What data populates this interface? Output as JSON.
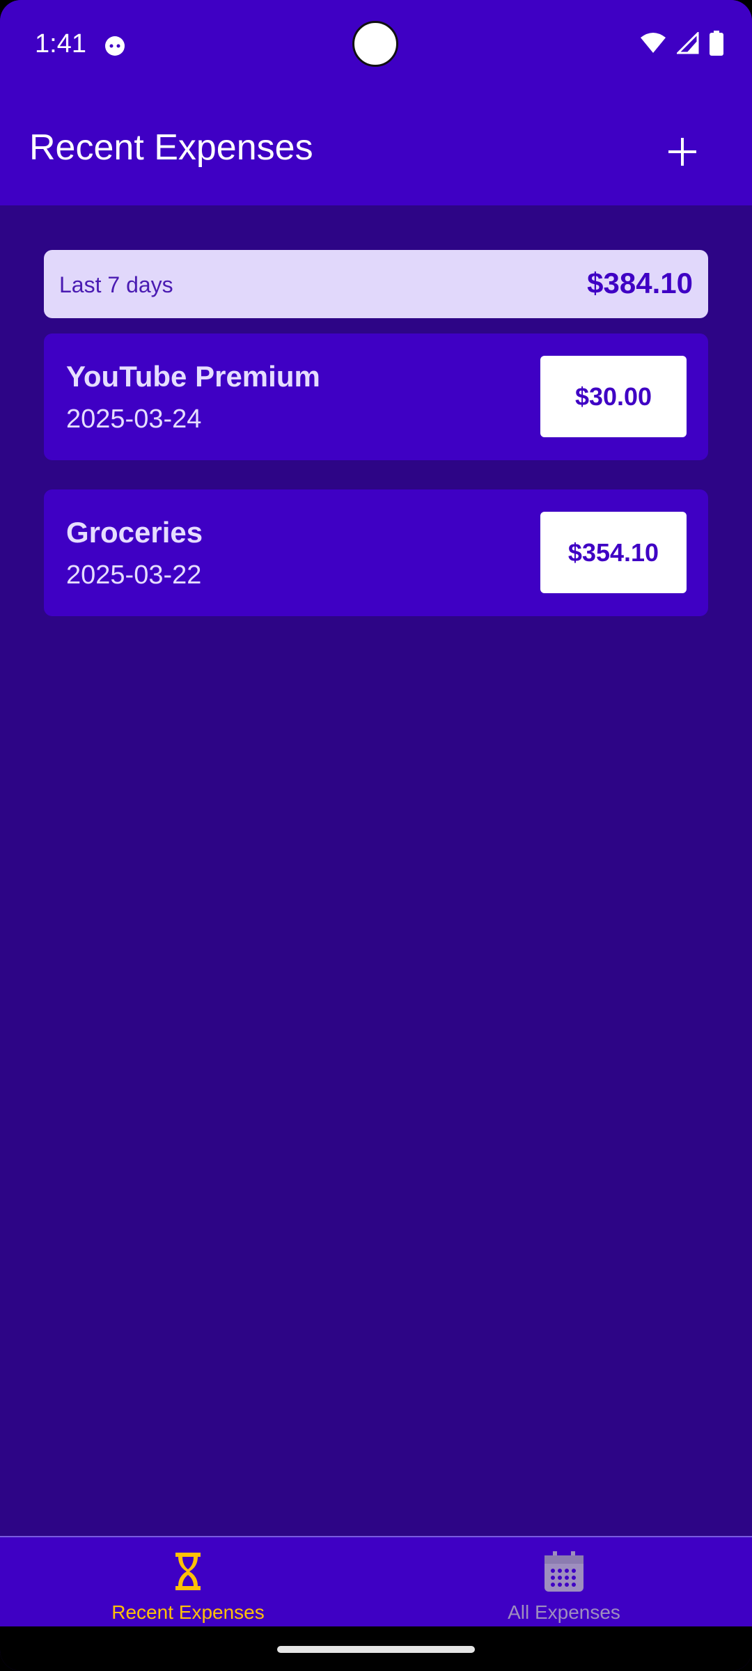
{
  "status_bar": {
    "time": "1:41",
    "icons": [
      "android-app-icon",
      "wifi-icon",
      "cellular-signal-icon",
      "battery-icon"
    ]
  },
  "app_bar": {
    "title": "Recent Expenses",
    "add_icon": "plus-icon"
  },
  "summary": {
    "label": "Last 7 days",
    "total": "$384.10"
  },
  "expenses": [
    {
      "title": "YouTube Premium",
      "date": "2025-03-24",
      "amount": "$30.00"
    },
    {
      "title": "Groceries",
      "date": "2025-03-22",
      "amount": "$354.10"
    }
  ],
  "bottom_nav": {
    "items": [
      {
        "label": "Recent Expenses",
        "icon": "hourglass-icon",
        "active": true
      },
      {
        "label": "All Expenses",
        "icon": "calendar-icon",
        "active": false
      }
    ]
  },
  "colors": {
    "primary": "#3f00c4",
    "background": "#2d0586",
    "accent": "#ffc107",
    "summary_bg": "#e1d8fb"
  }
}
